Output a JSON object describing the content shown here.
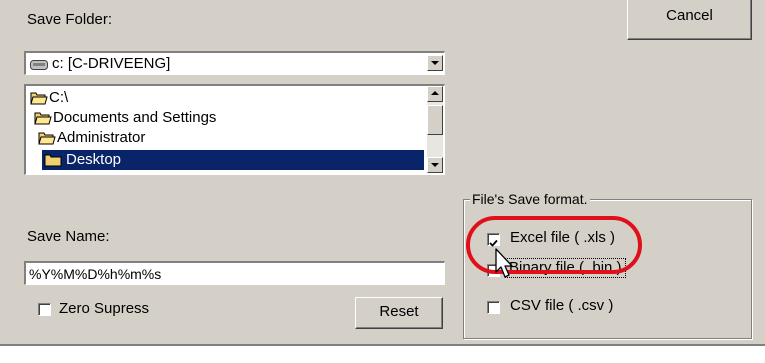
{
  "save_folder": {
    "label": "Save Folder:",
    "drive_select": "c: [C-DRIVEENG]"
  },
  "folder_tree": {
    "items": [
      {
        "label": "C:\\"
      },
      {
        "label": "Documents and Settings"
      },
      {
        "label": "Administrator"
      },
      {
        "label": "Desktop"
      }
    ]
  },
  "buttons": {
    "cancel": "Cancel",
    "reset": "Reset"
  },
  "save_name": {
    "label": "Save Name:",
    "value": "%Y%M%D%h%m%s"
  },
  "zero_supress": {
    "label": "Zero Supress",
    "checked": false
  },
  "save_format": {
    "title": "File's Save format.",
    "options": [
      {
        "label": "Excel file ( .xls )",
        "checked": true
      },
      {
        "label": "Binary file ( .bin )",
        "checked": false
      },
      {
        "label": "CSV file ( .csv )",
        "checked": false
      }
    ]
  },
  "colors": {
    "dialog_face": "#d4d0c8",
    "selection": "#0a246a",
    "highlight_circle": "#e0101a"
  }
}
